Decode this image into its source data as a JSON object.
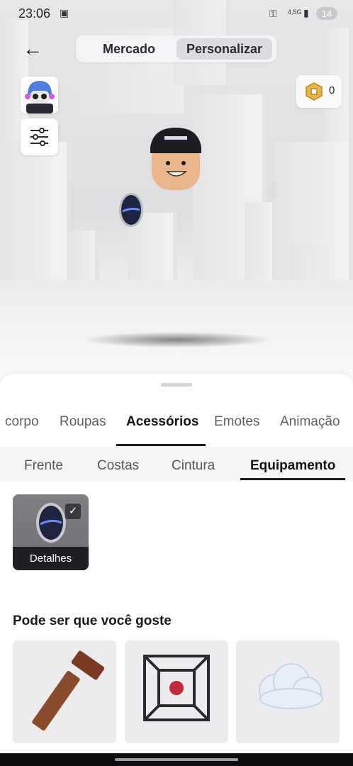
{
  "status": {
    "time": "23:06",
    "net": "4,5G",
    "battery": "14"
  },
  "header": {
    "back_icon": "arrow-left-icon",
    "tabs": [
      {
        "label": "Mercado",
        "active": false
      },
      {
        "label": "Personalizar",
        "active": true
      }
    ],
    "robux_icon": "robux-icon",
    "robux_value": "0"
  },
  "sheet": {
    "categories": [
      "corpo",
      "Roupas",
      "Acessórios",
      "Emotes",
      "Animação"
    ],
    "active_category": "Acessórios",
    "subcategories": [
      "Frente",
      "Costas",
      "Cintura",
      "Equipamento"
    ],
    "active_subcategory": "Equipamento",
    "equipped_item": {
      "details_label": "Detalhes",
      "selected": true
    },
    "recommend_title": "Pode ser que você goste",
    "recommend_items": [
      "sword-item",
      "tesseract-item",
      "cloud-item"
    ]
  },
  "colors": {
    "accent_underline": "#1b1b1f",
    "toggle_active_bg": "#dcdce0",
    "scene_bg": "#e4e4e6"
  }
}
